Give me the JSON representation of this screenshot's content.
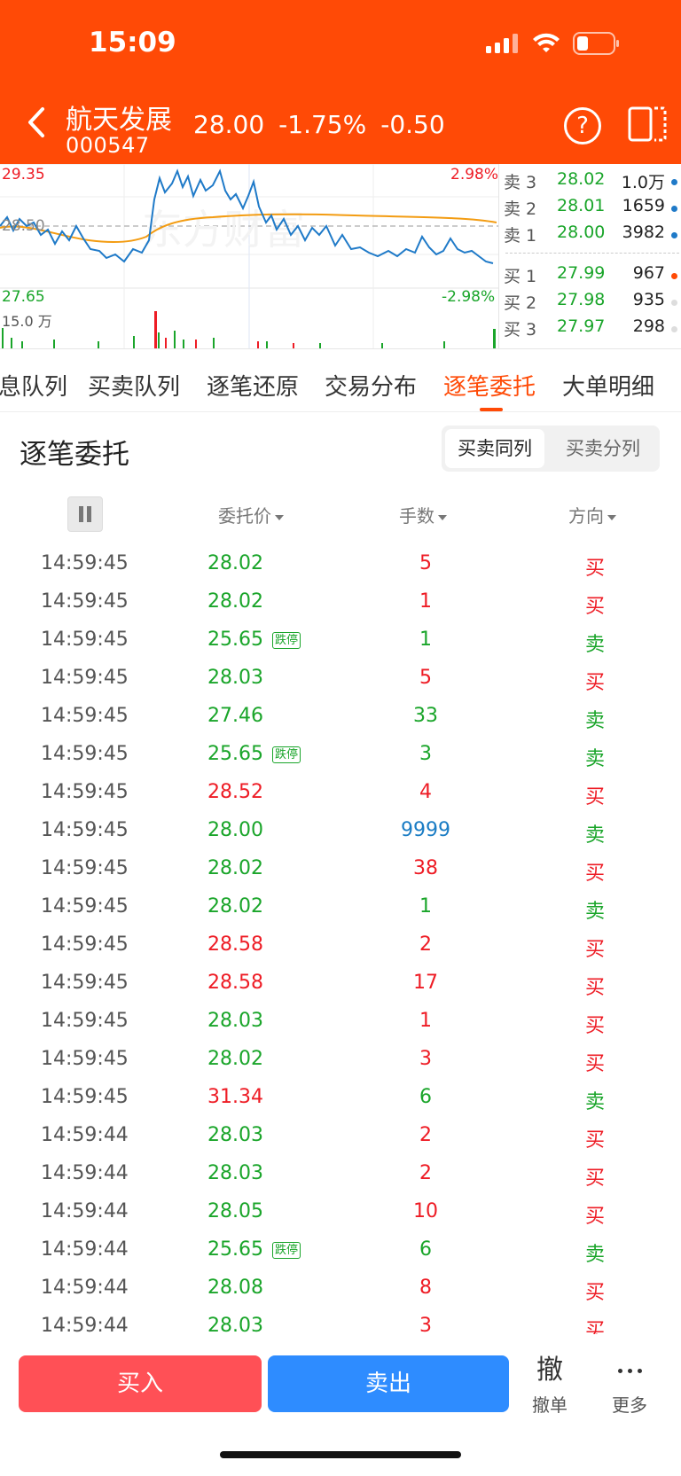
{
  "status": {
    "time": "15:09"
  },
  "stock": {
    "name": "航天发展",
    "code": "000547",
    "price": "28.00",
    "change_pct": "-1.75%",
    "change": "-0.50"
  },
  "mini_chart": {
    "high": "29.35",
    "low": "27.65",
    "ref": "28.50",
    "high_pct": "2.98%",
    "low_pct": "-2.98%",
    "vol_label": "15.0 万",
    "watermark": "东方财富"
  },
  "order_book": {
    "asks": [
      {
        "label": "卖 3",
        "price": "28.02",
        "vol": "1.0万"
      },
      {
        "label": "卖 2",
        "price": "28.01",
        "vol": "1659"
      },
      {
        "label": "卖 1",
        "price": "28.00",
        "vol": "3982"
      }
    ],
    "bids": [
      {
        "label": "买 1",
        "price": "27.99",
        "vol": "967"
      },
      {
        "label": "买 2",
        "price": "27.98",
        "vol": "935"
      },
      {
        "label": "买 3",
        "price": "27.97",
        "vol": "298"
      }
    ]
  },
  "tabs": [
    "息队列",
    "买卖队列",
    "逐笔还原",
    "交易分布",
    "逐笔委托",
    "大单明细"
  ],
  "active_tab": "逐笔委托",
  "section": {
    "title": "逐笔委托",
    "seg_same": "买卖同列",
    "seg_split": "买卖分列"
  },
  "columns": {
    "price": "委托价",
    "qty": "手数",
    "dir": "方向"
  },
  "rows": [
    {
      "time": "14:59:45",
      "price": "28.02",
      "tag": "",
      "qty": "5",
      "dir": "买"
    },
    {
      "time": "14:59:45",
      "price": "28.02",
      "tag": "",
      "qty": "1",
      "dir": "买"
    },
    {
      "time": "14:59:45",
      "price": "25.65",
      "tag": "跌停",
      "qty": "1",
      "dir": "卖"
    },
    {
      "time": "14:59:45",
      "price": "28.03",
      "tag": "",
      "qty": "5",
      "dir": "买"
    },
    {
      "time": "14:59:45",
      "price": "27.46",
      "tag": "",
      "qty": "33",
      "dir": "卖"
    },
    {
      "time": "14:59:45",
      "price": "25.65",
      "tag": "跌停",
      "qty": "3",
      "dir": "卖"
    },
    {
      "time": "14:59:45",
      "price": "28.52",
      "tag": "",
      "qty": "4",
      "dir": "买"
    },
    {
      "time": "14:59:45",
      "price": "28.00",
      "tag": "",
      "qty": "9999",
      "dir": "卖"
    },
    {
      "time": "14:59:45",
      "price": "28.02",
      "tag": "",
      "qty": "38",
      "dir": "买"
    },
    {
      "time": "14:59:45",
      "price": "28.02",
      "tag": "",
      "qty": "1",
      "dir": "卖"
    },
    {
      "time": "14:59:45",
      "price": "28.58",
      "tag": "",
      "qty": "2",
      "dir": "买"
    },
    {
      "time": "14:59:45",
      "price": "28.58",
      "tag": "",
      "qty": "17",
      "dir": "买"
    },
    {
      "time": "14:59:45",
      "price": "28.03",
      "tag": "",
      "qty": "1",
      "dir": "买"
    },
    {
      "time": "14:59:45",
      "price": "28.02",
      "tag": "",
      "qty": "3",
      "dir": "买"
    },
    {
      "time": "14:59:45",
      "price": "31.34",
      "tag": "",
      "qty": "6",
      "dir": "卖"
    },
    {
      "time": "14:59:44",
      "price": "28.03",
      "tag": "",
      "qty": "2",
      "dir": "买"
    },
    {
      "time": "14:59:44",
      "price": "28.03",
      "tag": "",
      "qty": "2",
      "dir": "买"
    },
    {
      "time": "14:59:44",
      "price": "28.05",
      "tag": "",
      "qty": "10",
      "dir": "买"
    },
    {
      "time": "14:59:44",
      "price": "25.65",
      "tag": "跌停",
      "qty": "6",
      "dir": "卖"
    },
    {
      "time": "14:59:44",
      "price": "28.08",
      "tag": "",
      "qty": "8",
      "dir": "买"
    },
    {
      "time": "14:59:44",
      "price": "28.03",
      "tag": "",
      "qty": "3",
      "dir": "买"
    }
  ],
  "colors": {
    "up": "#ee1c25",
    "down": "#1aa52a",
    "big": "#1a7cc4",
    "brand": "#ff4a06"
  },
  "bottom": {
    "buy": "买入",
    "sell": "卖出",
    "cancel_glyph": "撤",
    "cancel": "撤单",
    "more": "更多"
  }
}
